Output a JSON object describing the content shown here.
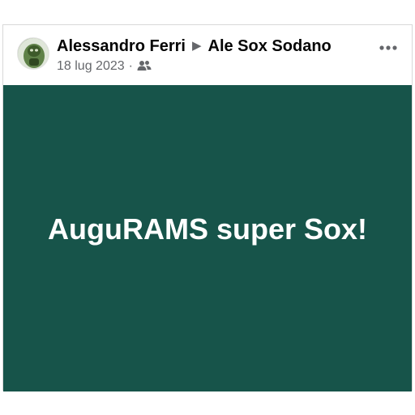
{
  "post": {
    "author": "Alessandro Ferri",
    "recipient": "Ale Sox Sodano",
    "date": "18 lug 2023",
    "separator": "·",
    "audience_icon": "friends-icon",
    "more_icon": "more-options-icon",
    "text": "AuguRAMS super Sox!",
    "background_color": "#17544a",
    "text_color": "#ffffff"
  }
}
